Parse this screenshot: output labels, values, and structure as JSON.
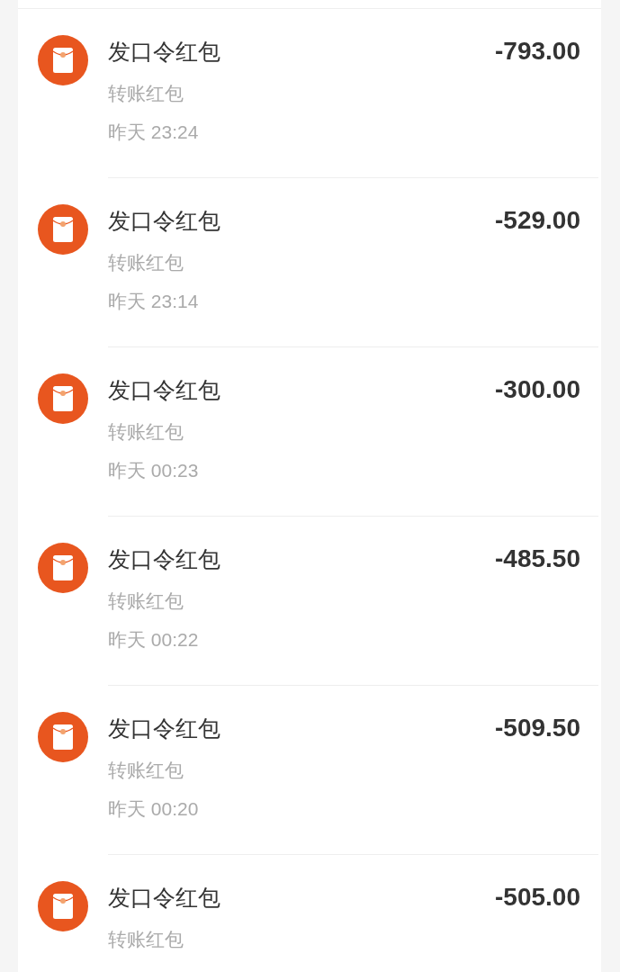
{
  "transactions": [
    {
      "title": "发口令红包",
      "subtitle": "转账红包",
      "time": "昨天 23:24",
      "amount": "-793.00"
    },
    {
      "title": "发口令红包",
      "subtitle": "转账红包",
      "time": "昨天 23:14",
      "amount": "-529.00"
    },
    {
      "title": "发口令红包",
      "subtitle": "转账红包",
      "time": "昨天 00:23",
      "amount": "-300.00"
    },
    {
      "title": "发口令红包",
      "subtitle": "转账红包",
      "time": "昨天 00:22",
      "amount": "-485.50"
    },
    {
      "title": "发口令红包",
      "subtitle": "转账红包",
      "time": "昨天 00:20",
      "amount": "-509.50"
    },
    {
      "title": "发口令红包",
      "subtitle": "转账红包",
      "amount": "-505.00"
    }
  ]
}
